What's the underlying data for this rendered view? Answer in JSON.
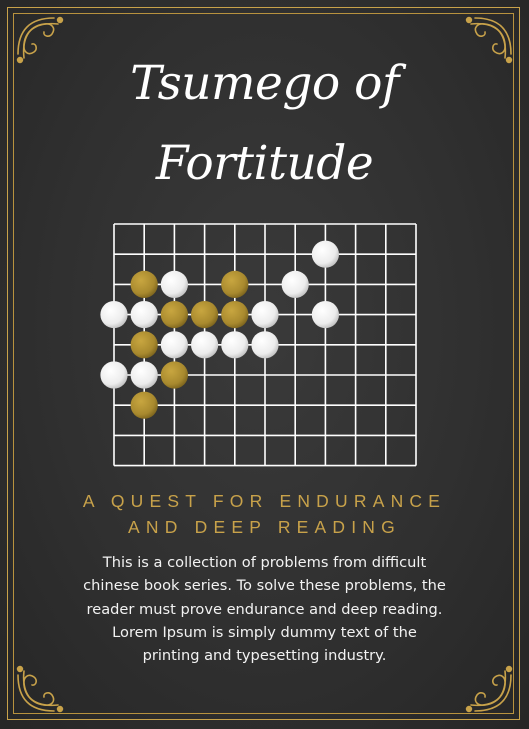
{
  "title": {
    "line1": "Tsumego of",
    "line2": "Fortitude"
  },
  "subtitle": {
    "line1": "A QUEST FOR ENDURANCE",
    "line2": "AND DEEP READING"
  },
  "description": {
    "lines": [
      "This is a collection of problems from difficult",
      "chinese book series. To solve these problems, the",
      "reader must prove endurance and deep reading.",
      "Lorem Ipsum is simply dummy text of the",
      "printing and typesetting industry."
    ]
  },
  "colors": {
    "background": "#303030",
    "border_gold": "#c8a24a",
    "grid_lines": "#ffffff",
    "gold_stone": "#a8892e",
    "white_stone": "#f4f4f4",
    "title_text": "#ffffff",
    "body_text": "#f2f2f2"
  },
  "board": {
    "columns": 11,
    "rows": 9,
    "note": "",
    "stones": [
      {
        "color": "white",
        "col": 7,
        "row": 0
      },
      {
        "color": "gold",
        "col": 1,
        "row": 1
      },
      {
        "color": "white",
        "col": 2,
        "row": 1
      },
      {
        "color": "gold",
        "col": 4,
        "row": 1
      },
      {
        "color": "white",
        "col": 6,
        "row": 1
      },
      {
        "color": "white",
        "col": 0,
        "row": 2
      },
      {
        "color": "white",
        "col": 1,
        "row": 2
      },
      {
        "color": "gold",
        "col": 2,
        "row": 2
      },
      {
        "color": "gold",
        "col": 3,
        "row": 2
      },
      {
        "color": "gold",
        "col": 4,
        "row": 2
      },
      {
        "color": "white",
        "col": 5,
        "row": 2
      },
      {
        "color": "white",
        "col": 7,
        "row": 2
      },
      {
        "color": "gold",
        "col": 1,
        "row": 3
      },
      {
        "color": "white",
        "col": 2,
        "row": 3
      },
      {
        "color": "white",
        "col": 3,
        "row": 3
      },
      {
        "color": "white",
        "col": 4,
        "row": 3
      },
      {
        "color": "white",
        "col": 5,
        "row": 3
      },
      {
        "color": "white",
        "col": 0,
        "row": 4
      },
      {
        "color": "white",
        "col": 1,
        "row": 4
      },
      {
        "color": "gold",
        "col": 2,
        "row": 4
      },
      {
        "color": "gold",
        "col": 1,
        "row": 5
      }
    ]
  }
}
